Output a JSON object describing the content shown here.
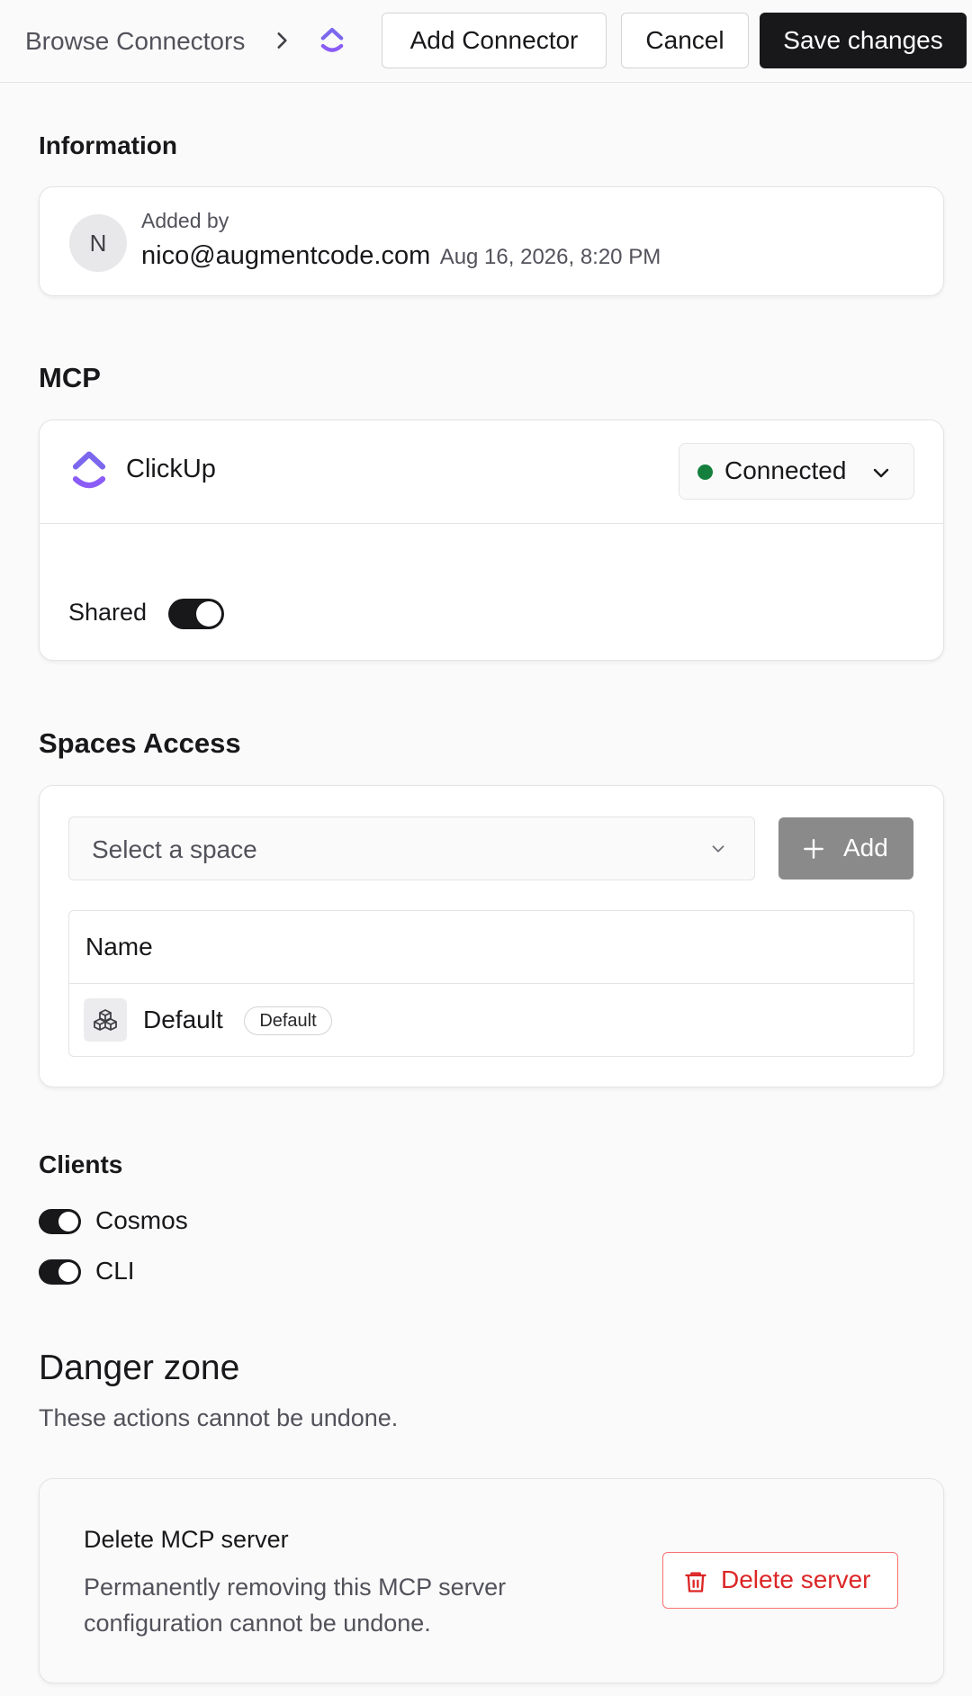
{
  "header": {
    "breadcrumb_label": "Browse Connectors",
    "add_connector_label": "Add Connector",
    "cancel_label": "Cancel",
    "save_label": "Save changes"
  },
  "information": {
    "title": "Information",
    "avatar_initial": "N",
    "added_by_label": "Added by",
    "email": "nico@augmentcode.com",
    "date": "Aug 16, 2026, 8:20 PM"
  },
  "mcp": {
    "title": "MCP",
    "name": "ClickUp",
    "status": "Connected",
    "shared_label": "Shared",
    "shared_on": true
  },
  "spaces": {
    "title": "Spaces Access",
    "select_placeholder": "Select a space",
    "add_label": "Add",
    "table_header": "Name",
    "rows": [
      {
        "name": "Default",
        "badge": "Default"
      }
    ]
  },
  "clients": {
    "title": "Clients",
    "items": [
      {
        "name": "Cosmos",
        "enabled": true
      },
      {
        "name": "CLI",
        "enabled": true
      }
    ]
  },
  "danger": {
    "title": "Danger zone",
    "subtitle": "These actions cannot be undone.",
    "delete_title": "Delete MCP server",
    "delete_desc_line1": "Permanently removing this MCP server",
    "delete_desc_line2": "configuration cannot be undone.",
    "delete_button": "Delete server"
  },
  "colors": {
    "accent_dark": "#18181b",
    "status_green": "#15803d",
    "danger_red": "#dc2626",
    "clickup_purple": "#7b68ee"
  },
  "icons": {
    "breadcrumb_separator": "chevron-right-icon",
    "connector_logo": "clickup-logo-icon",
    "status_dropdown": "chevron-down-icon",
    "add": "plus-icon",
    "space": "cubes-icon",
    "delete": "trash-icon"
  }
}
